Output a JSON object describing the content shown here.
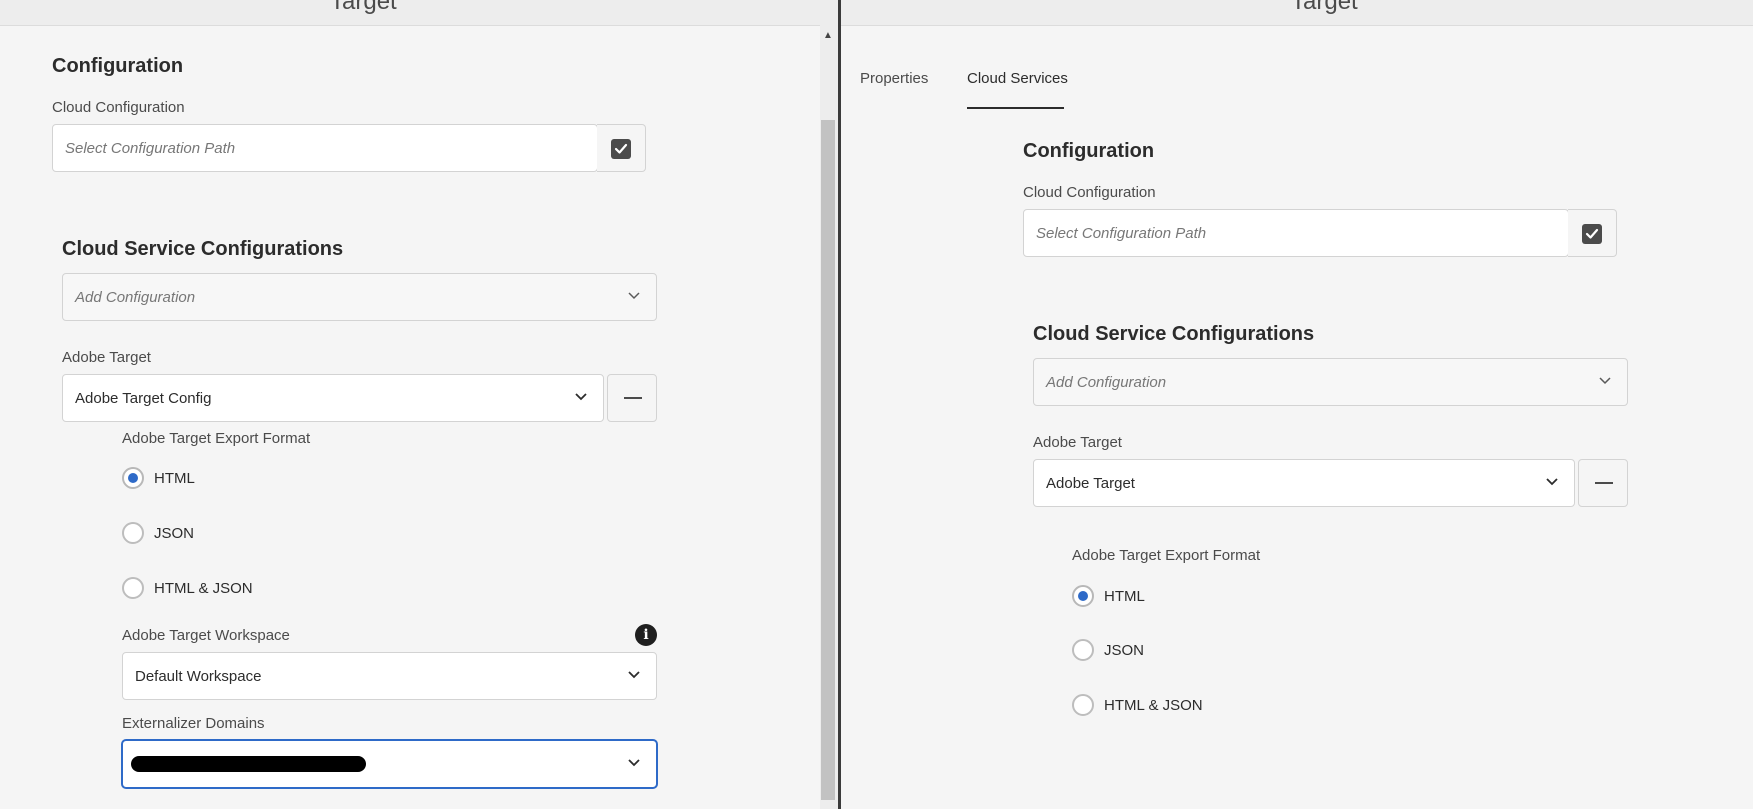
{
  "left": {
    "title": "Target",
    "configuration": {
      "heading": "Configuration",
      "cloud_config_label": "Cloud Configuration",
      "path_placeholder": "Select Configuration Path"
    },
    "csc": {
      "heading": "Cloud Service Configurations",
      "add_placeholder": "Add Configuration",
      "adobe_target_label": "Adobe Target",
      "adobe_target_value": "Adobe Target Config",
      "export_format_label": "Adobe Target Export Format",
      "radios": [
        "HTML",
        "JSON",
        "HTML & JSON"
      ],
      "selected": "HTML",
      "workspace_label": "Adobe Target Workspace",
      "workspace_value": "Default Workspace",
      "externalizer_label": "Externalizer Domains"
    }
  },
  "right": {
    "title": "Target",
    "tabs": [
      "Properties",
      "Cloud Services"
    ],
    "active_tab": "Cloud Services",
    "configuration": {
      "heading": "Configuration",
      "cloud_config_label": "Cloud Configuration",
      "path_placeholder": "Select Configuration Path"
    },
    "csc": {
      "heading": "Cloud Service Configurations",
      "add_placeholder": "Add Configuration",
      "adobe_target_label": "Adobe Target",
      "adobe_target_value": "Adobe Target",
      "export_format_label": "Adobe Target Export Format",
      "radios": [
        "HTML",
        "JSON",
        "HTML & JSON"
      ],
      "selected": "HTML"
    }
  },
  "colors": {
    "accent": "#2e6ac8",
    "background": "#f5f5f5",
    "text": "#2c2c2c"
  },
  "icons": {
    "path_picker": "checkbox-icon",
    "dropdown": "chevron-down-icon",
    "remove": "minus-icon",
    "info": "info-icon"
  }
}
